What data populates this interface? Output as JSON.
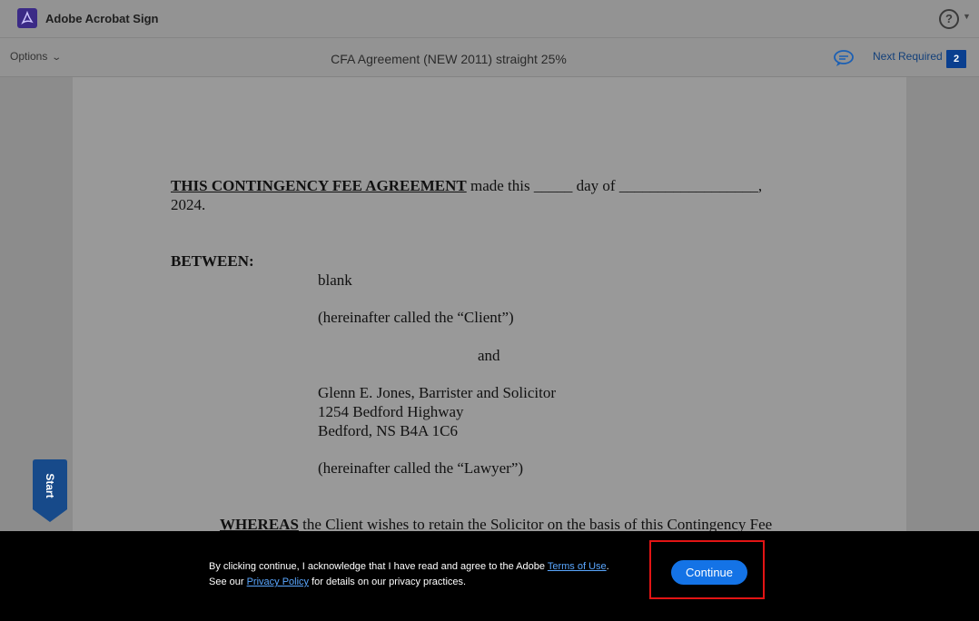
{
  "header": {
    "app_title": "Adobe Acrobat Sign",
    "help_label": "?"
  },
  "toolbar": {
    "options_label": "Options",
    "doc_title": "CFA Agreement (NEW 2011) straight 25%",
    "next_required_label": "Next Required",
    "next_required_count": "2"
  },
  "document": {
    "line1_bold": "THIS CONTINGENCY FEE AGREEMENT",
    "line1_rest": " made this _____ day of __________________,",
    "line2": "2024.",
    "between": "BETWEEN:",
    "client_name": "blank",
    "client_called": "(hereinafter called the “Client”)",
    "and": "and",
    "lawyer_name": "Glenn E. Jones, Barrister and Solicitor",
    "lawyer_address1": "1254 Bedford Highway",
    "lawyer_address2": "Bedford, NS B4A 1C6",
    "lawyer_called": "(hereinafter called the “Lawyer”)",
    "whereas_bold": "WHEREAS",
    "whereas_rest": " the Client wishes to retain the Solicitor on the basis of this Contingency Fee"
  },
  "start_tab": {
    "label": "Start"
  },
  "consent": {
    "text_part1": "By clicking continue, I acknowledge that I have read and agree to the Adobe ",
    "terms_link": "Terms of Use",
    "text_part2": ". See our ",
    "privacy_link": "Privacy Policy",
    "text_part3": " for details on our privacy practices.",
    "continue_label": "Continue"
  }
}
